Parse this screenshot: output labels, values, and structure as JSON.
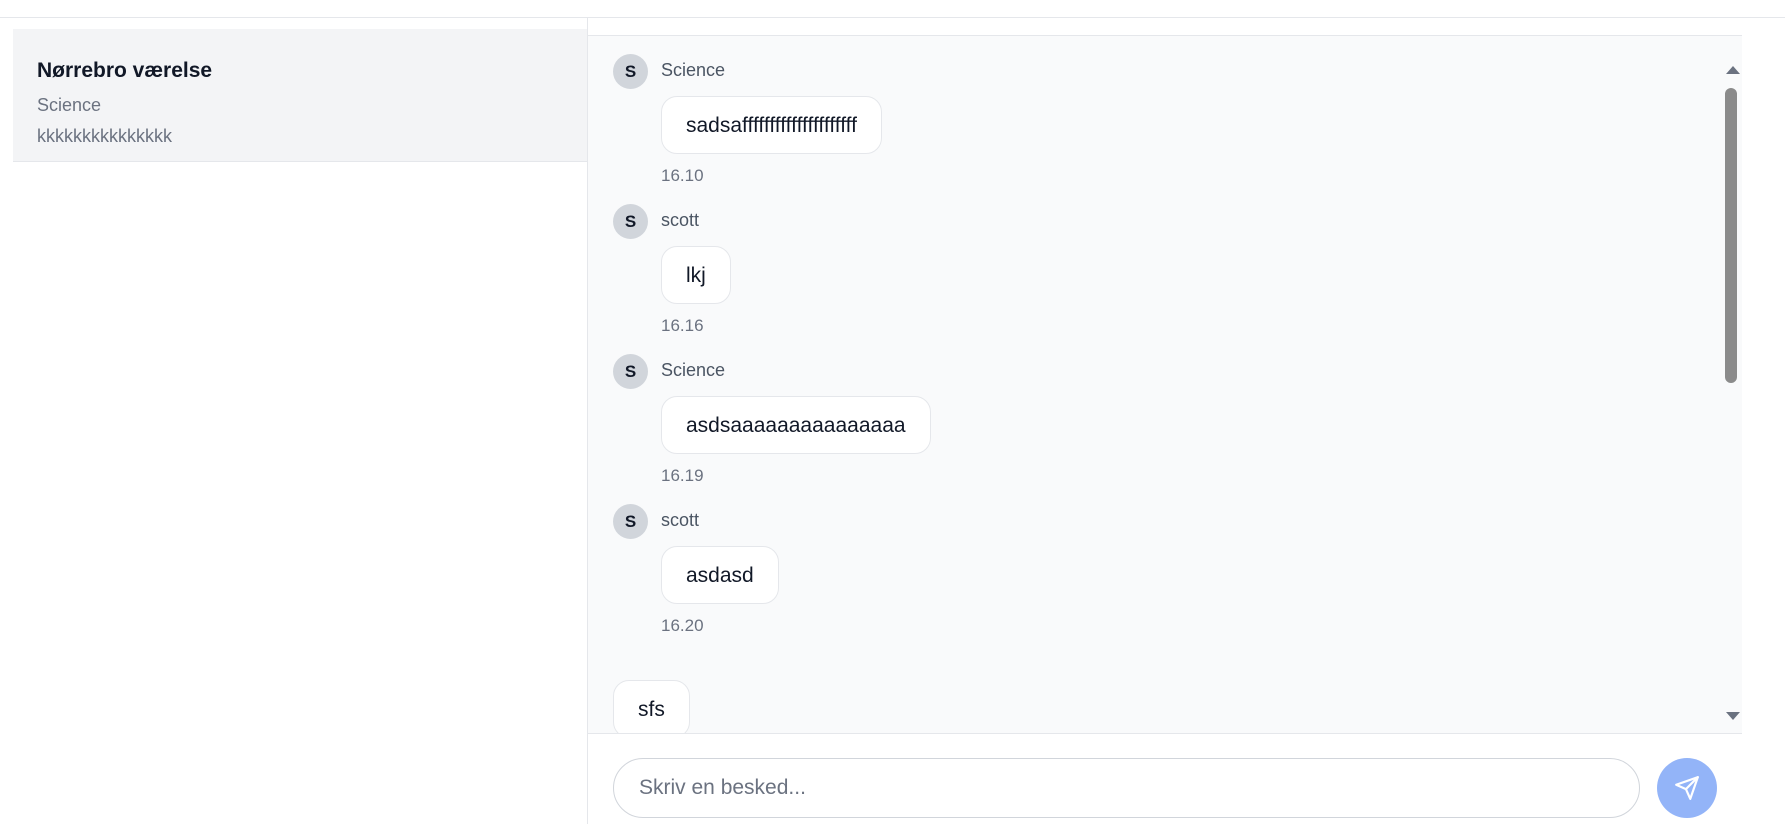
{
  "conversation": {
    "name": "Nørrebro værelse",
    "subtitle": "Science",
    "last_message": "kkkkkkkkkkkkkkk"
  },
  "messages": [
    {
      "avatar": "S",
      "sender": "Science",
      "text": "sadsafffffffffffffffffffff",
      "time": "16.10"
    },
    {
      "avatar": "S",
      "sender": "scott",
      "text": "lkj",
      "time": "16.16"
    },
    {
      "avatar": "S",
      "sender": "Science",
      "text": "asdsaaaaaaaaaaaaaaa",
      "time": "16.19"
    },
    {
      "avatar": "S",
      "sender": "scott",
      "text": "asdasd",
      "time": "16.20"
    },
    {
      "text": "sfs"
    }
  ],
  "composer": {
    "placeholder": "Skriv en besked..."
  },
  "icons": {
    "send": "send-icon",
    "scroll_up": "scroll-up-arrow-icon",
    "scroll_down": "scroll-down-arrow-icon"
  },
  "colors": {
    "send_button": "#93b4f8",
    "selected_conversation": "#f3f4f6",
    "messages_bg": "#f9fafb"
  }
}
